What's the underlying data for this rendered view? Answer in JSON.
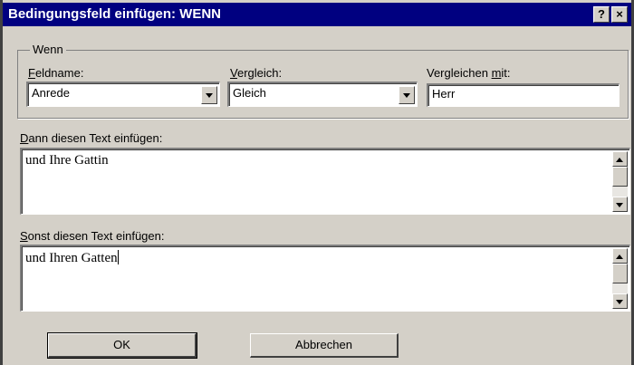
{
  "window": {
    "title": "Bedingungsfeld einfügen: WENN",
    "help_glyph": "?",
    "close_glyph": "×"
  },
  "group": {
    "label": "Wenn"
  },
  "fieldname": {
    "label_accel": "F",
    "label_rest": "eldname:",
    "value": "Anrede"
  },
  "comparison": {
    "label_accel": "V",
    "label_rest": "ergleich:",
    "value": "Gleich"
  },
  "compare_with": {
    "label_pre": "Vergleichen ",
    "label_accel": "m",
    "label_rest": "it:",
    "value": "Herr"
  },
  "then_text": {
    "label_accel": "D",
    "label_rest": "ann diesen Text einfügen:",
    "value": "und Ihre Gattin"
  },
  "else_text": {
    "label_accel": "S",
    "label_rest": "onst diesen Text einfügen:",
    "value": "und Ihren Gatten"
  },
  "buttons": {
    "ok": "OK",
    "cancel": "Abbrechen"
  }
}
